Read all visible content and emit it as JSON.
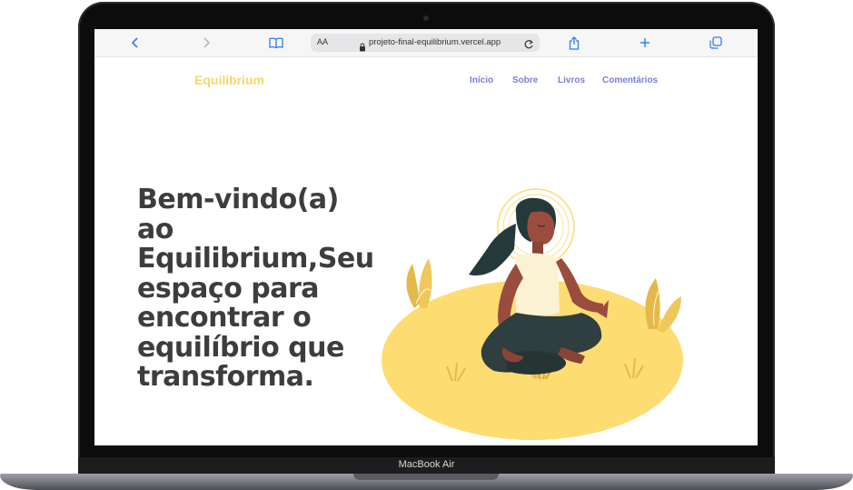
{
  "browser": {
    "text_size_label": "AA",
    "url": "projeto-final-equilibrium.vercel.app"
  },
  "site": {
    "brand": "Equilibrium",
    "nav": [
      "Início",
      "Sobre",
      "Livros",
      "Comentários"
    ],
    "hero_title": "Bem-vindo(a) ao Equilibrium,Seu espaço para encontrar o equilíbrio que transforma."
  },
  "device": {
    "model": "MacBook Air"
  },
  "colors": {
    "brand": "#f5d76e",
    "nav_link": "#7a7fd8",
    "heading": "#3d3d3d",
    "illustration_yellow": "#fddc72",
    "browser_accent": "#2f7bf6"
  },
  "icons": [
    "back-icon",
    "forward-icon",
    "bookmarks-icon",
    "lock-icon",
    "reload-icon",
    "share-icon",
    "new-tab-icon",
    "tabs-icon"
  ]
}
